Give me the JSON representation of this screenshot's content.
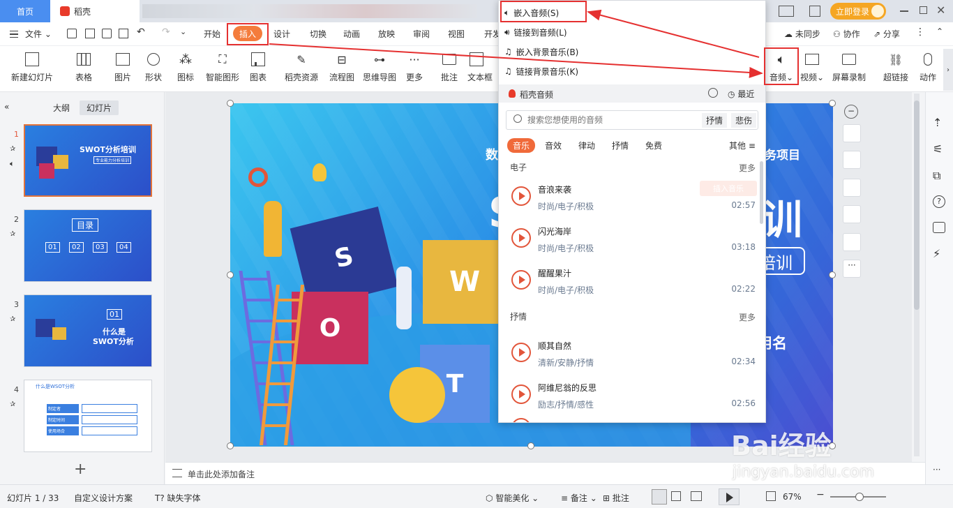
{
  "titlebar": {
    "home_tab": "首页",
    "app_tab": "稻壳",
    "login_button": "立即登录"
  },
  "menubar": {
    "file_menu": "文件",
    "tabs": [
      "开始",
      "插入",
      "设计",
      "切换",
      "动画",
      "放映",
      "审阅",
      "视图",
      "开发"
    ],
    "sync_status": "未同步",
    "collaborate": "协作",
    "share": "分享"
  },
  "ribbon": {
    "items": [
      "新建幻灯片",
      "表格",
      "图片",
      "形状",
      "图标",
      "智能图形",
      "图表",
      "稻壳资源",
      "流程图",
      "思维导图",
      "更多",
      "批注",
      "文本框",
      "音频",
      "视频",
      "屏幕录制",
      "超链接",
      "动作"
    ]
  },
  "leftpane": {
    "tabs": [
      "大纲",
      "幻灯片"
    ],
    "add_button": "+",
    "thumbs": [
      {
        "num": "1",
        "title": "SWOT分析培训",
        "subtitle": "专业能力分析培训"
      },
      {
        "num": "2",
        "title": "目录",
        "items": [
          "01",
          "02",
          "03",
          "04"
        ]
      },
      {
        "num": "3",
        "title": "01",
        "subtitle": "什么是",
        "subtitle2": "SWOT分析"
      },
      {
        "num": "4",
        "title": "什么是WSOT分析",
        "rows": [
          "制定者",
          "制定时间",
          "使用场合"
        ]
      }
    ]
  },
  "slide": {
    "left_title_fragment": "数",
    "right_title_fragment": "务项目",
    "big_letter": "S",
    "big_right": "训",
    "subtitle_right": "培训",
    "name_label": "用名",
    "puzzle_letters": [
      "S",
      "W",
      "O",
      "T"
    ]
  },
  "dropdown": {
    "menu_items": [
      "嵌入音频(S)",
      "链接到音频(L)",
      "嵌入背景音乐(B)",
      "链接背景音乐(K)"
    ],
    "panel_title": "稻壳音频",
    "recent": "最近",
    "search_placeholder": "搜索您想使用的音频",
    "search_tags": [
      "抒情",
      "悲伤"
    ],
    "categories": [
      "音乐",
      "音效",
      "律动",
      "抒情",
      "免费"
    ],
    "other": "其他",
    "sections": [
      {
        "name": "电子",
        "more": "更多",
        "songs": [
          {
            "title": "音浪来袭",
            "tags": "时尚/电子/积极",
            "duration": "02:57"
          },
          {
            "title": "闪光海岸",
            "tags": "时尚/电子/积极",
            "duration": "03:18"
          },
          {
            "title": "醒醒果汁",
            "tags": "时尚/电子/积极",
            "duration": "02:22"
          }
        ]
      },
      {
        "name": "抒情",
        "more": "更多",
        "songs": [
          {
            "title": "顺其自然",
            "tags": "清新/安静/抒情",
            "duration": "02:34"
          },
          {
            "title": "阿维尼翁的反思",
            "tags": "励志/抒情/感性",
            "duration": "02:56"
          }
        ]
      }
    ],
    "insert_badge": "插入音乐"
  },
  "notes": {
    "placeholder": "单击此处添加备注"
  },
  "status": {
    "slide_count": "幻灯片 1 / 33",
    "design_scheme": "自定义设计方案",
    "missing_font": "缺失字体",
    "smart_beautify": "智能美化",
    "notes": "备注",
    "comments": "批注",
    "zoom": "67%"
  },
  "watermark": {
    "brand": "Bai经验",
    "url": "jingyan.baidu.com"
  }
}
